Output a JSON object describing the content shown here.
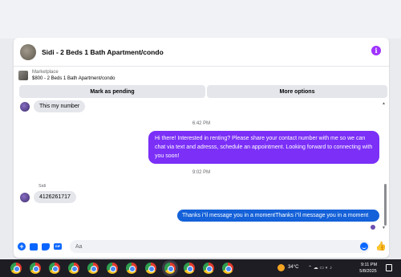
{
  "header": {
    "title": "Sidi - 2 Beds 1 Bath Apartment/condo",
    "info_icon": "info-icon"
  },
  "listing": {
    "source": "Marketplace",
    "price_title": "$800 - 2 Beds 1 Bath Apartment/condo"
  },
  "actions": {
    "mark_pending": "Mark as pending",
    "more_options": "More options"
  },
  "messages": [
    {
      "direction": "in",
      "text": "This my number"
    },
    {
      "type": "timestamp",
      "text": "6:42 PM"
    },
    {
      "direction": "out",
      "text": "Hi there! Interested in renting? Please share your contact number with me so we can chat via text and adresss, schedule an appointment. Looking forward to connecting with you soon!"
    },
    {
      "type": "timestamp",
      "text": "9:02 PM"
    },
    {
      "direction": "in",
      "sender": "Sidi",
      "text": "4126261717"
    },
    {
      "direction": "out",
      "text": "Thanks i\"il message you in a momentThanks i\"il message you in a moment"
    }
  ],
  "composer": {
    "placeholder": "Aa",
    "icons": [
      "plus-circle-icon",
      "photo-icon",
      "sticker-icon",
      "gif-icon",
      "emoji-icon",
      "thumbs-up-icon"
    ]
  },
  "taskbar": {
    "weather_temp": "34°C",
    "time": "9:11 PM",
    "date": "5/8/2025",
    "tray_symbols": "⌃ ☁ ▭ ◐ ♪"
  },
  "colors": {
    "accent_blue": "#0866ff",
    "outgoing_purple": "#7b2ff7",
    "outgoing_blue": "#1461d9",
    "info_purple": "#a033ff",
    "incoming_gray": "#e4e6eb"
  }
}
